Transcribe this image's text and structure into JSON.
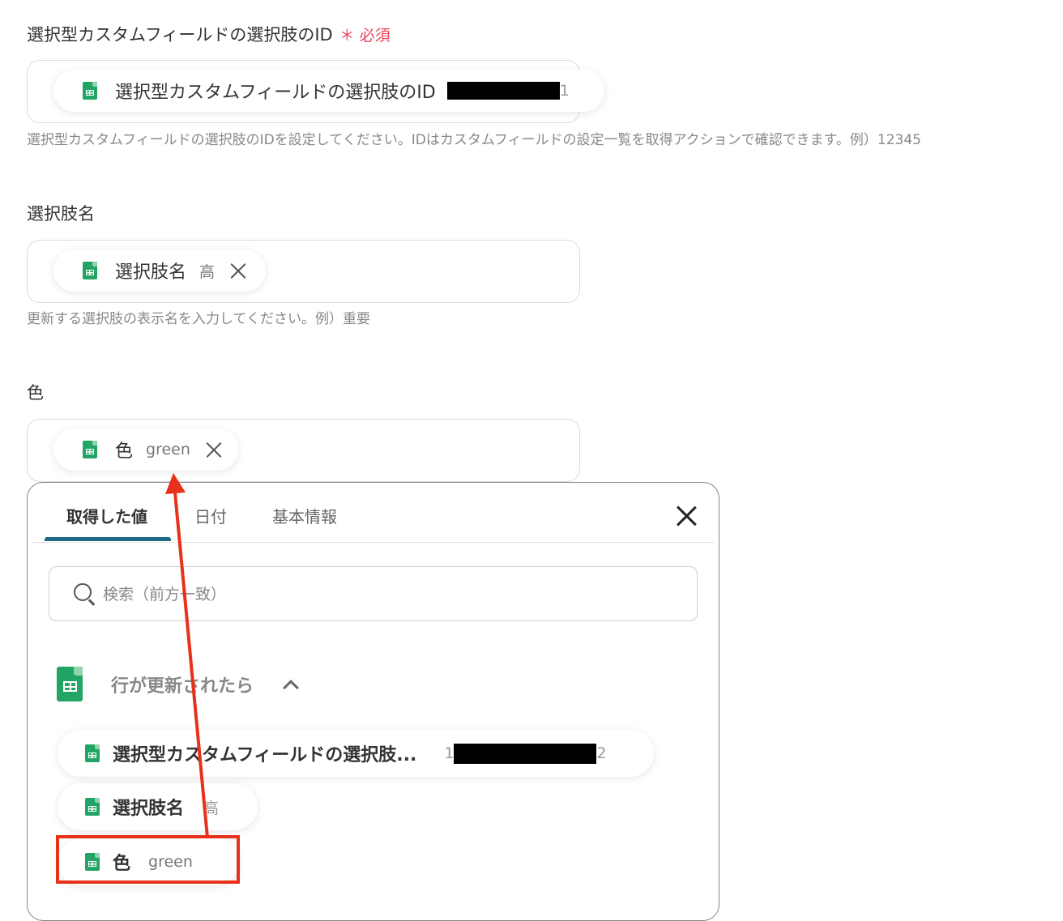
{
  "field_id": {
    "label": "選択型カスタムフィールドの選択肢のID",
    "required_mark": "＊",
    "required_text": "必須",
    "chip_name": "選択型カスタムフィールドの選択肢のID",
    "chip_value_tail": "1",
    "help": "選択型カスタムフィールドの選択肢のIDを設定してください。IDはカスタムフィールドの設定一覧を取得アクションで確認できます。例）12345"
  },
  "field_name": {
    "label": "選択肢名",
    "chip_name": "選択肢名",
    "chip_value": "高",
    "help": "更新する選択肢の表示名を入力してください。例）重要"
  },
  "field_color": {
    "label": "色",
    "chip_name": "色",
    "chip_value": "green"
  },
  "panel": {
    "tabs": [
      {
        "label": "取得した値"
      },
      {
        "label": "日付"
      },
      {
        "label": "基本情報"
      }
    ],
    "search_placeholder": "検索（前方一致）",
    "group_title": "行が更新されたら",
    "items": [
      {
        "name": "選択型カスタムフィールドの選択肢...",
        "value_head": "1",
        "value_tail": "2"
      },
      {
        "name": "選択肢名",
        "value": "高"
      },
      {
        "name": "色",
        "value": "green"
      }
    ]
  },
  "colors": {
    "accent_tab": "#1b6b83",
    "required": "#e8445a",
    "annotation": "#e8311b",
    "sheets_green": "#21a464"
  },
  "icons": [
    "google-sheets-icon",
    "close-icon",
    "search-icon",
    "chevron-up-icon"
  ]
}
